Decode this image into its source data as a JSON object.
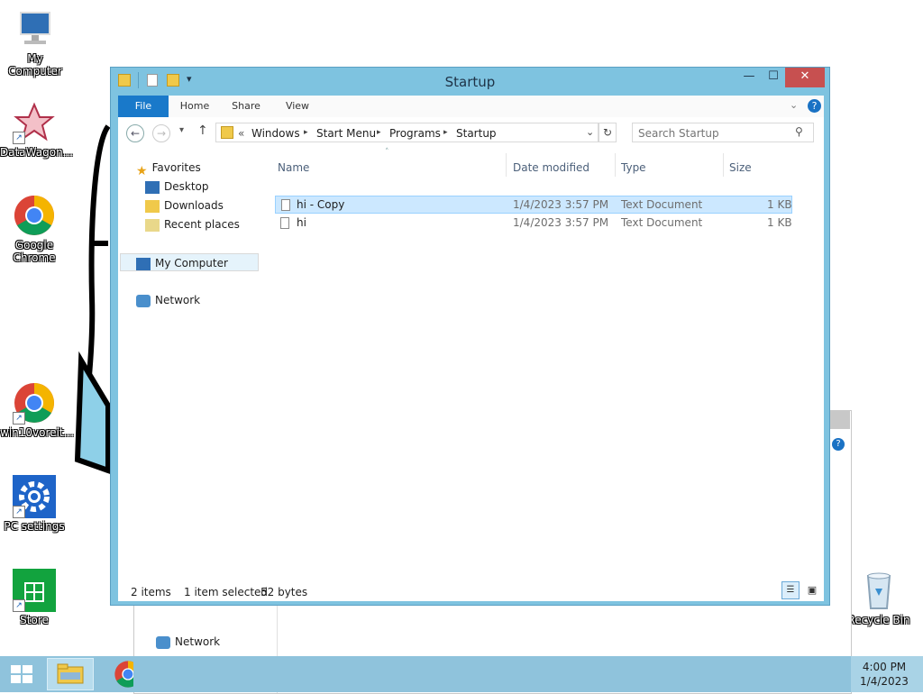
{
  "desktop": {
    "icons": [
      {
        "label": "My Computer"
      },
      {
        "label": "DataWagon..."
      },
      {
        "label": "Google Chrome"
      },
      {
        "label": "win10voreit..."
      },
      {
        "label": "PC settings"
      },
      {
        "label": "Store"
      },
      {
        "label": "Recycle Bin"
      }
    ]
  },
  "taskbar": {
    "time": "4:00 PM",
    "date": "1/4/2023"
  },
  "backwindow": {
    "nav_network": "Network"
  },
  "window": {
    "title": "Startup",
    "ribbon": {
      "file": "File",
      "home": "Home",
      "share": "Share",
      "view": "View"
    },
    "address": {
      "prefix": "«",
      "crumbs": [
        "Windows",
        "Start Menu",
        "Programs",
        "Startup"
      ]
    },
    "search": {
      "placeholder": "Search Startup"
    },
    "nav": {
      "favorites": "Favorites",
      "desktop": "Desktop",
      "downloads": "Downloads",
      "recent": "Recent places",
      "computer": "My Computer",
      "network": "Network"
    },
    "columns": {
      "name": "Name",
      "date": "Date modified",
      "type": "Type",
      "size": "Size"
    },
    "files": [
      {
        "name": "hi - Copy",
        "date": "1/4/2023 3:57 PM",
        "type": "Text Document",
        "size": "1 KB",
        "selected": true
      },
      {
        "name": "hi",
        "date": "1/4/2023 3:57 PM",
        "type": "Text Document",
        "size": "1 KB",
        "selected": false
      }
    ],
    "status": {
      "count": "2 items",
      "selection": "1 item selected",
      "bytes": "52 bytes"
    }
  },
  "colors": {
    "window_frame": "#7ec3e0",
    "close_button": "#c75050",
    "file_tab": "#1979ca",
    "selection": "#cce8ff",
    "taskbar": "#8fc3dc"
  }
}
